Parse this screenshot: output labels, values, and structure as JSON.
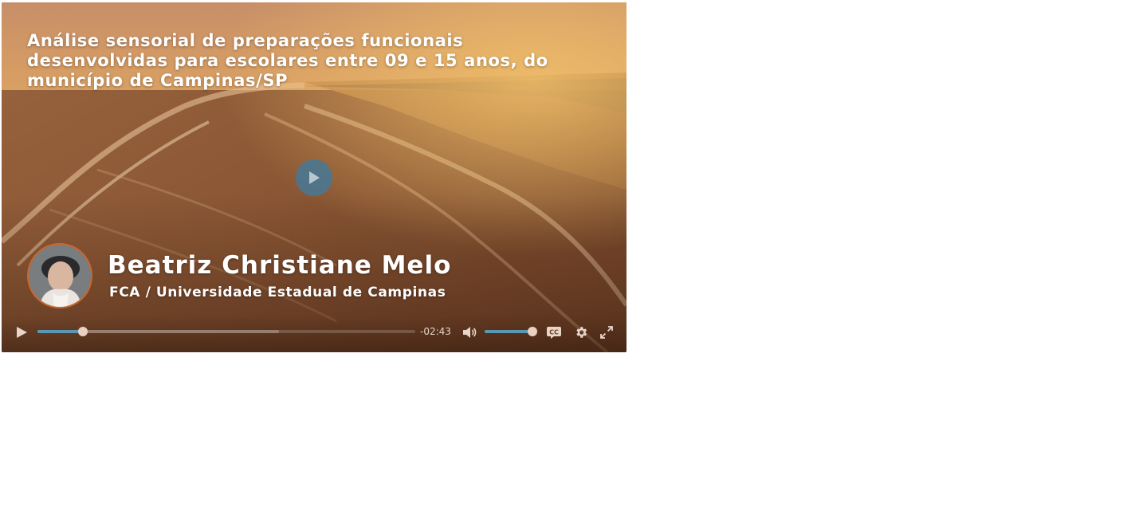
{
  "video": {
    "title": "Análise sensorial de preparações funcionais desenvolvidas para escolares entre 09 e 15 anos, do município de Campinas/SP",
    "presenter_name": "Beatriz Christiane Melo",
    "presenter_affiliation": "FCA / Universidade Estadual de Campinas"
  },
  "controls": {
    "time_remaining": "-02:43",
    "progress_played_fraction": 0.12,
    "progress_buffered_fraction": 0.64,
    "volume_fraction": 1.0,
    "icons": [
      "play-icon",
      "volume-icon",
      "captions-icon",
      "settings-icon",
      "fullscreen-icon"
    ]
  },
  "colors": {
    "accent": "#5a97b5",
    "avatar_border": "#c9672e",
    "thumb": "#e9d2c2"
  }
}
